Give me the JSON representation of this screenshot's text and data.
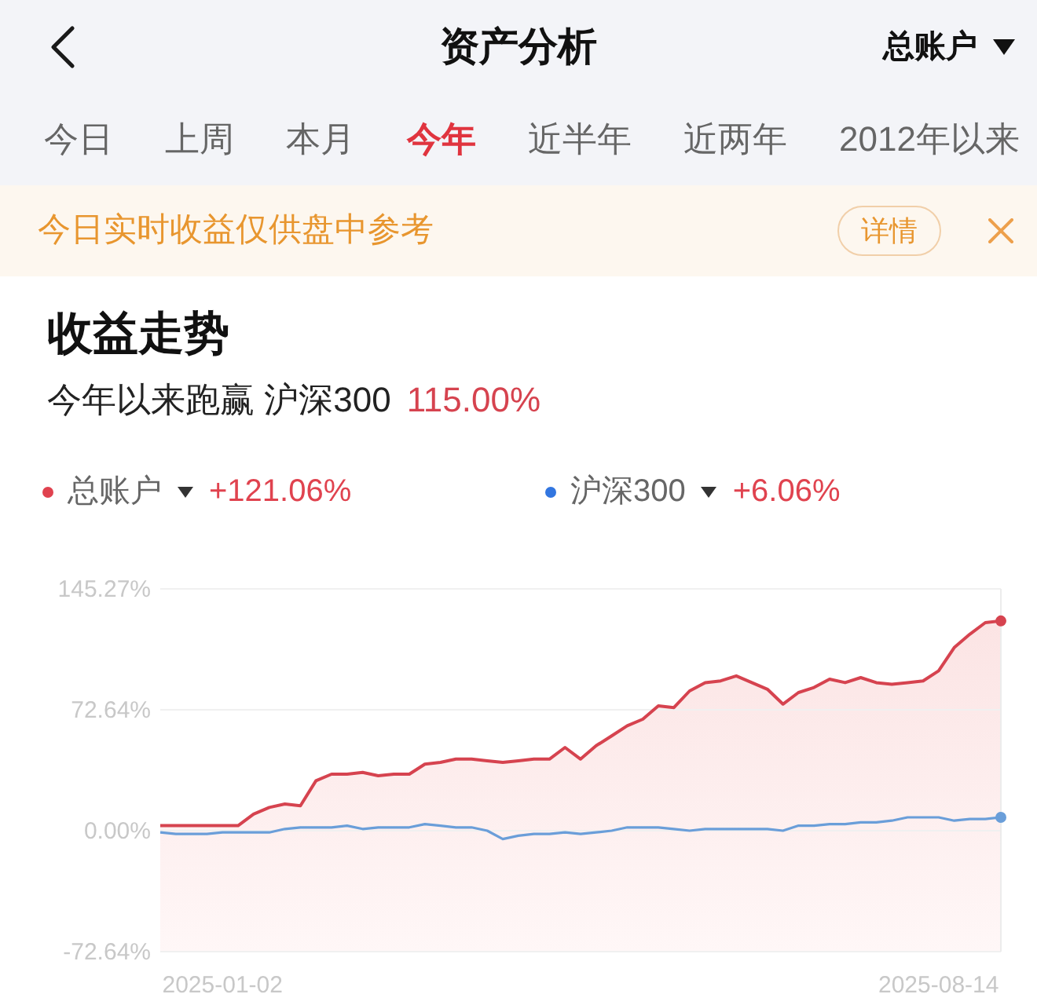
{
  "header": {
    "title": "资产分析",
    "account": "总账户"
  },
  "tabs": [
    {
      "label": "今日",
      "selected": false
    },
    {
      "label": "上周",
      "selected": false
    },
    {
      "label": "本月",
      "selected": false
    },
    {
      "label": "今年",
      "selected": true
    },
    {
      "label": "近半年",
      "selected": false
    },
    {
      "label": "近两年",
      "selected": false
    },
    {
      "label": "2012年以来",
      "selected": false
    }
  ],
  "notice": {
    "text": "今日实时收益仅供盘中参考",
    "button": "详情"
  },
  "trend": {
    "title": "收益走势",
    "subtitle": "今年以来跑赢 沪深300",
    "subtitle_value": "115.00%",
    "legend": [
      {
        "color": "#e0424f",
        "value": "+121.06%"
      },
      {
        "color": "#3276e0",
        "value": "+6.06%"
      }
    ],
    "chart_data": {
      "type": "line",
      "categories": [
        null,
        null,
        null,
        null,
        "2025-01-02",
        null,
        null,
        null,
        null,
        null,
        null,
        null,
        null,
        null,
        null,
        null,
        null,
        null,
        null,
        null,
        null,
        null,
        null,
        null,
        null,
        null,
        null,
        null,
        null,
        null,
        null,
        null,
        null,
        null,
        null,
        null,
        null,
        null,
        null,
        null,
        null,
        null,
        null,
        null,
        null,
        null,
        null,
        null,
        null,
        null,
        "2025-08-14",
        null,
        null,
        null,
        null
      ],
      "series": [
        {
          "name": "总账户",
          "type": "area",
          "color": "#d6434f",
          "values": [
            3,
            3,
            3,
            3,
            3,
            3,
            10,
            14,
            16,
            15,
            30,
            34,
            34,
            35,
            33,
            34,
            34,
            40,
            41,
            43,
            43,
            42,
            41,
            42,
            43,
            43,
            50,
            43,
            51,
            57,
            63,
            67,
            75,
            74,
            84,
            89,
            90,
            93,
            89,
            85,
            76,
            83,
            86,
            91,
            89,
            92,
            89,
            88,
            89,
            90,
            96,
            110,
            118,
            125,
            126
          ]
        },
        {
          "name": "沪深300",
          "type": "line",
          "color": "#6a9ed9",
          "values": [
            -1,
            -2,
            -2,
            -2,
            -1,
            -1,
            -1,
            -1,
            1,
            2,
            2,
            2,
            3,
            1,
            2,
            2,
            2,
            4,
            3,
            2,
            2,
            0,
            -5,
            -3,
            -2,
            -2,
            -1,
            -2,
            -1,
            0,
            2,
            2,
            2,
            1,
            0,
            1,
            1,
            1,
            1,
            1,
            0,
            3,
            3,
            4,
            4,
            5,
            5,
            6,
            8,
            8,
            8,
            6,
            7,
            7,
            8
          ]
        }
      ],
      "ylim": [
        -72.64,
        145.27
      ],
      "yticks": [
        {
          "value": -72.64,
          "label": "-72.64%"
        },
        {
          "value": 0,
          "label": "0.00%"
        },
        {
          "value": 72.64,
          "label": "72.64%"
        },
        {
          "value": 145.27,
          "label": "145.27%"
        }
      ]
    }
  }
}
